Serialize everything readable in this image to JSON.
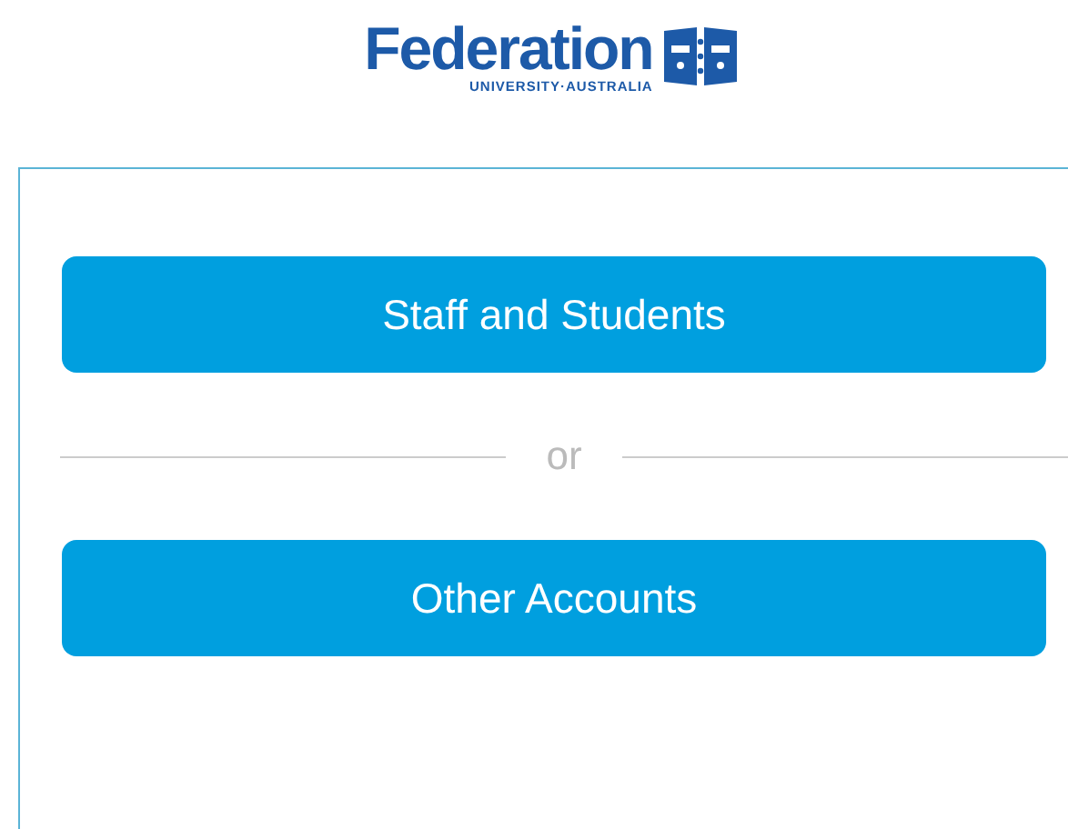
{
  "logo": {
    "name": "Federation",
    "subtitle": "UNIVERSITY·AUSTRALIA"
  },
  "login_options": [
    {
      "label": "Staff and Students"
    },
    {
      "label": "Other Accounts"
    }
  ],
  "divider": "or"
}
